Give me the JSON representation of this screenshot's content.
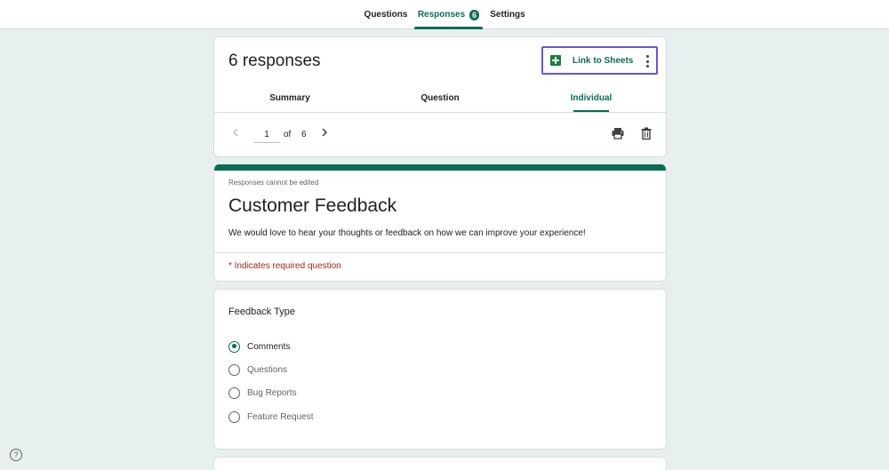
{
  "top_tabs": [
    {
      "label": "Questions"
    },
    {
      "label": "Responses",
      "badge": "6"
    },
    {
      "label": "Settings"
    }
  ],
  "responses_card": {
    "count_title": "6 responses",
    "link_sheets_label": "Link to Sheets",
    "view_tabs": [
      {
        "label": "Summary"
      },
      {
        "label": "Question"
      },
      {
        "label": "Individual"
      }
    ],
    "pager": {
      "current": "1",
      "of_label": "of",
      "total": "6"
    }
  },
  "form": {
    "edit_note": "Responses cannot be edited",
    "title": "Customer Feedback",
    "description": "We would love to hear your thoughts or feedback on how we can improve your experience!",
    "required_note": "* Indicates required question"
  },
  "question": {
    "title": "Feedback Type",
    "options": [
      {
        "label": "Comments",
        "selected": true
      },
      {
        "label": "Questions",
        "selected": false
      },
      {
        "label": "Bug Reports",
        "selected": false
      },
      {
        "label": "Feature Request",
        "selected": false
      }
    ]
  },
  "help_label": "?",
  "colors": {
    "accent": "#0c6b58",
    "background": "#e7f0ef",
    "required": "#a52714",
    "focus_outline": "#6b52d6",
    "sheets_green": "#188038"
  },
  "icons": [
    "sheets-icon",
    "more-vert-icon",
    "chevron-left-icon",
    "chevron-right-icon",
    "print-icon",
    "trash-icon",
    "help-icon"
  ]
}
